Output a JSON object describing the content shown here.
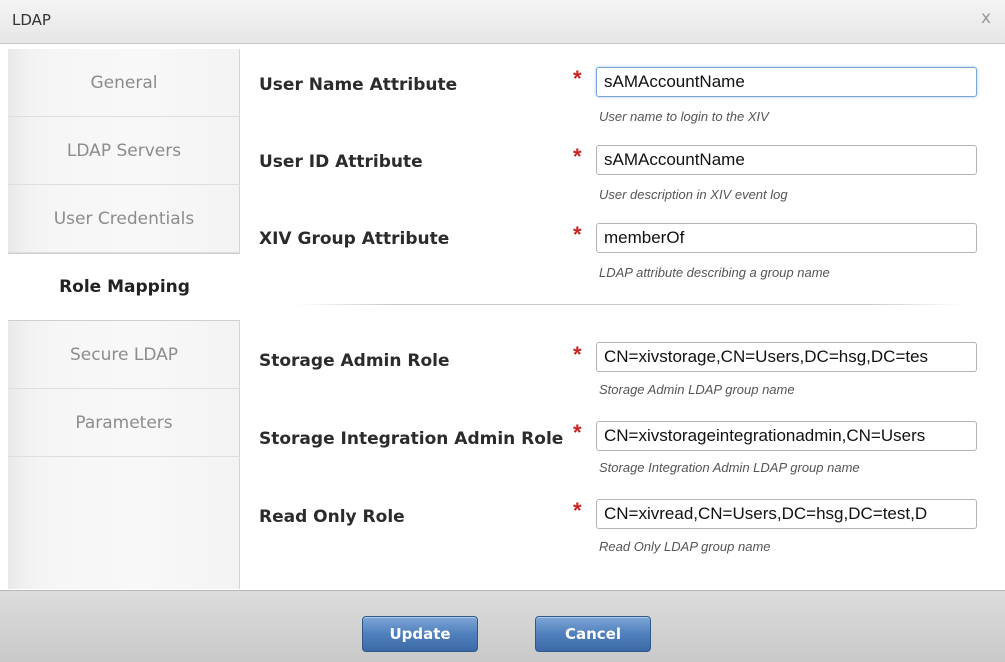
{
  "dialog": {
    "title": "LDAP",
    "close_label": "x"
  },
  "sidebar": {
    "tabs": [
      {
        "label": "General",
        "active": false
      },
      {
        "label": "LDAP Servers",
        "active": false
      },
      {
        "label": "User Credentials",
        "active": false
      },
      {
        "label": "Role Mapping",
        "active": true
      },
      {
        "label": "Secure LDAP",
        "active": false
      },
      {
        "label": "Parameters",
        "active": false
      }
    ]
  },
  "form": {
    "required_marker": "*",
    "fields": [
      {
        "label": "User Name Attribute",
        "value": "sAMAccountName",
        "hint": "User name to login to the XIV"
      },
      {
        "label": "User ID Attribute",
        "value": "sAMAccountName",
        "hint": "User description in XIV event log"
      },
      {
        "label": "XIV Group Attribute",
        "value": "memberOf",
        "hint": "LDAP attribute describing a group name"
      },
      {
        "label": "Storage Admin Role",
        "value": "CN=xivstorage,CN=Users,DC=hsg,DC=tes",
        "hint": "Storage Admin LDAP group name"
      },
      {
        "label": "Storage Integration Admin Role",
        "value": "CN=xivstorageintegrationadmin,CN=Users",
        "hint": "Storage Integration Admin LDAP group name"
      },
      {
        "label": "Read Only Role",
        "value": "CN=xivread,CN=Users,DC=hsg,DC=test,D",
        "hint": "Read Only LDAP group name"
      }
    ]
  },
  "footer": {
    "update_label": "Update",
    "cancel_label": "Cancel"
  },
  "colors": {
    "accent_button": "#4f7fbc",
    "required": "#cc2222",
    "active_tab_text": "#222222",
    "inactive_tab_text": "#8c8c8c"
  }
}
